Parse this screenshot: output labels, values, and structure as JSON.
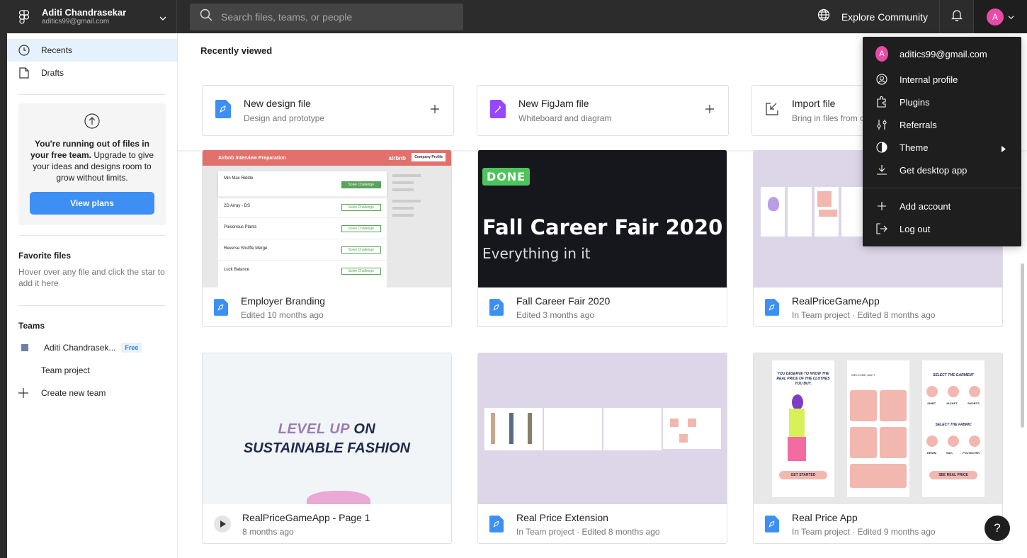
{
  "account": {
    "name": "Aditi Chandrasekar",
    "email": "aditics99@gmail.com",
    "avatar_letter": "A"
  },
  "search": {
    "placeholder": "Search files, teams, or people"
  },
  "topbar": {
    "explore_label": "Explore Community"
  },
  "sidebar": {
    "nav": [
      {
        "label": "Recents",
        "icon": "clock-icon"
      },
      {
        "label": "Drafts",
        "icon": "file-icon"
      }
    ],
    "upgrade": {
      "msg_bold": "You're running out of files in your free team.",
      "msg_rest": " Upgrade to give your ideas and designs room to grow without limits.",
      "button": "View plans"
    },
    "favorites": {
      "title": "Favorite files",
      "hint": "Hover over any file and click the star to add it here"
    },
    "teams": {
      "title": "Teams",
      "team_name": "Aditi Chandrasek...",
      "badge": "Free",
      "project": "Team project",
      "create": "Create new team"
    }
  },
  "main": {
    "heading": "Recently viewed",
    "create_cards": [
      {
        "title": "New design file",
        "subtitle": "Design and prototype"
      },
      {
        "title": "New FigJam file",
        "subtitle": "Whiteboard and diagram"
      },
      {
        "title": "Import file",
        "subtitle": "Bring in files from o"
      }
    ],
    "files": [
      {
        "title": "Employer Branding",
        "subtitle": "Edited 10 months ago"
      },
      {
        "title": "Fall Career Fair 2020",
        "subtitle": "Edited 3 months ago"
      },
      {
        "title": "RealPriceGameApp",
        "subtitle": "In Team project · Edited 8 months ago"
      },
      {
        "title": "RealPriceGameApp - Page 1",
        "subtitle": "8 months ago"
      },
      {
        "title": "Real Price Extension",
        "subtitle": "In Team project · Edited 8 months ago"
      },
      {
        "title": "Real Price App",
        "subtitle": "In Team project · Edited 9 months ago"
      }
    ],
    "thumbs": {
      "airbnb_header": "Airbnb Interview Preparation",
      "airbnb_brand": "airbnb",
      "airbnb_btn": "Company Profile",
      "airbnb_rows": [
        "Min Max Riddle",
        "2D Array - DS",
        "Poisonous Plants",
        "Reverse Shuffle Merge",
        "Luck Balance"
      ],
      "airbnb_row_btn": "Solve Challenge",
      "career_badge": "DONE",
      "career_title": "Fall Career Fair 2020",
      "career_sub": "Everything in it",
      "fashion_line1a": "LEVEL UP",
      "fashion_line1b": " ON",
      "fashion_line2": "SUSTAINABLE FASHION",
      "app_headline": "YOU DESERVE TO KNOW THE REAL PRICE OF THE CLOTHES YOU BUY.",
      "app_get_started": "GET STARTED",
      "app_welcome": "WELCOME, ADITI",
      "app_select_garment": "SELECT THE GARMENT",
      "app_garments": [
        "SHIRT",
        "JACKET",
        "SHORTS"
      ],
      "app_select_fabric": "SELECT THE FABRIC",
      "app_fabrics": [
        "DENIM",
        "SILK",
        "POLYESTER"
      ],
      "app_see_price": "SEE REAL PRICE"
    }
  },
  "dropdown": {
    "items": [
      {
        "label": "aditics99@gmail.com",
        "icon": "avatar"
      },
      {
        "label": "Internal profile",
        "icon": "user-circle-icon"
      },
      {
        "label": "Plugins",
        "icon": "plugin-icon"
      },
      {
        "label": "Referrals",
        "icon": "referrals-icon"
      },
      {
        "label": "Theme",
        "icon": "theme-icon"
      },
      {
        "label": "Get desktop app",
        "icon": "download-icon"
      }
    ],
    "add_account": "Add account",
    "log_out": "Log out"
  },
  "help": "?"
}
